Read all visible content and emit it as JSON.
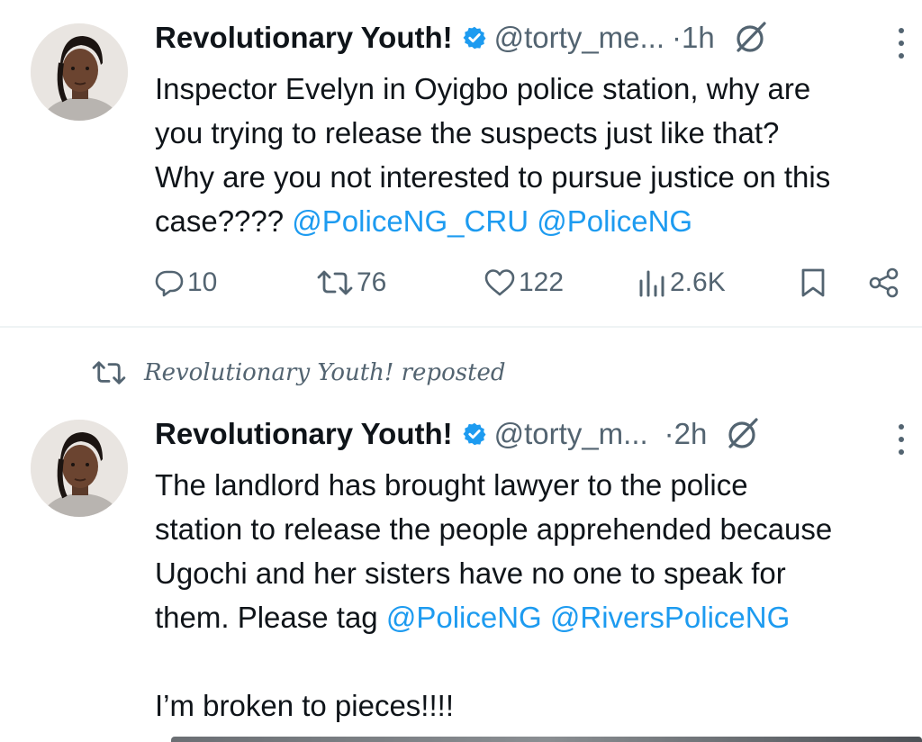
{
  "tweets": [
    {
      "author_name": "Revolutionary Youth!",
      "handle": "@torty_me...",
      "separator": "·",
      "time": "1h",
      "text_parts": [
        {
          "text": "Inspector Evelyn in Oyigbo police station, why are\nyou trying to release the suspects just like that?\nWhy are you not interested to pursue justice on this\ncase???? ",
          "type": "text"
        },
        {
          "text": "@PoliceNG_CRU",
          "type": "mention"
        },
        {
          "text": " ",
          "type": "text"
        },
        {
          "text": "@PoliceNG",
          "type": "mention"
        }
      ],
      "stats": {
        "replies": "10",
        "reposts": "76",
        "likes": "122",
        "views": "2.6K"
      }
    },
    {
      "repost_label": "Revolutionary Youth! reposted",
      "author_name": "Revolutionary Youth!",
      "handle": "@torty_m...",
      "separator": "·",
      "time": "2h",
      "text_parts": [
        {
          "text": "The landlord has brought lawyer to the police\nstation to release the people apprehended because\nUgochi and her sisters have no one to speak for\nthem. Please tag ",
          "type": "text"
        },
        {
          "text": "@PoliceNG",
          "type": "mention"
        },
        {
          "text": " ",
          "type": "text"
        },
        {
          "text": "@RiversPoliceNG",
          "type": "mention"
        },
        {
          "text": "\n\nI’m broken to pieces!!!!",
          "type": "text"
        }
      ]
    }
  ],
  "colors": {
    "text": "#0f1419",
    "secondary": "#536471",
    "link": "#1d9bf0",
    "verified": "#1d9bf0",
    "divider": "#eff3f4"
  },
  "icons": [
    "verified-badge-icon",
    "grok-icon",
    "more-icon",
    "reply-icon",
    "repost-icon",
    "like-icon",
    "views-icon",
    "bookmark-icon",
    "share-icon"
  ]
}
